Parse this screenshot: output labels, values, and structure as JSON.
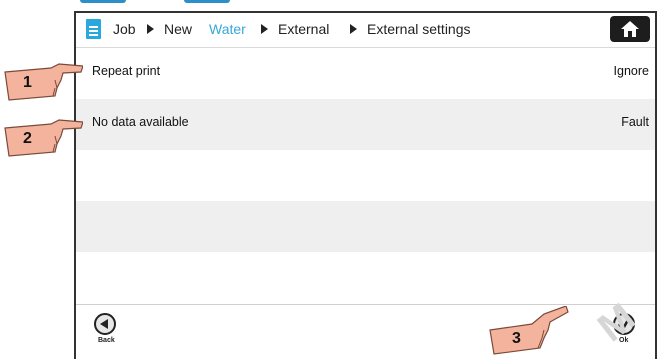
{
  "breadcrumb": {
    "items": [
      "Job",
      "New",
      "Water",
      "External",
      "External settings"
    ],
    "active_item": "Water"
  },
  "rows": [
    {
      "label": "Repeat print",
      "value": "Ignore"
    },
    {
      "label": "No data available",
      "value": "Fault"
    },
    {
      "label": "",
      "value": ""
    },
    {
      "label": "",
      "value": ""
    },
    {
      "label": "",
      "value": ""
    }
  ],
  "footer": {
    "back_label": "Back",
    "ok_label": "Ok"
  },
  "callouts": [
    "1",
    "2",
    "3"
  ],
  "colors": {
    "accent": "#35a8d8",
    "row_stripe": "#efefef",
    "hand_fill": "#f4b39c"
  }
}
